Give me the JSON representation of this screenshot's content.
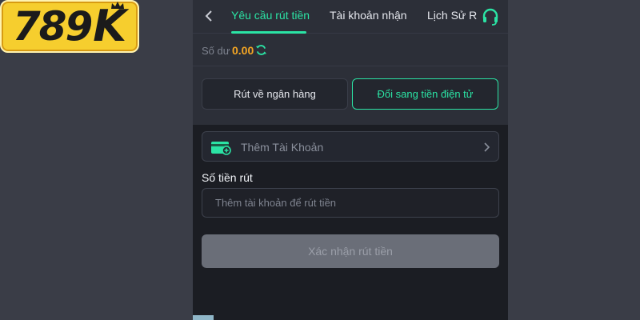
{
  "logo": {
    "numbers": "789",
    "letter": "K"
  },
  "tabs": [
    {
      "label": "Yêu cầu rút tiền",
      "active": true
    },
    {
      "label": "Tài khoản nhận",
      "active": false
    },
    {
      "label": "Lịch Sử R",
      "active": false
    }
  ],
  "balance": {
    "label": "Số dư",
    "value": "0.00"
  },
  "methods": {
    "bank": "Rút về ngân hàng",
    "crypto": "Đổi sang tiền điện tử",
    "selected": "crypto"
  },
  "add_account": {
    "label": "Thêm Tài Khoản"
  },
  "amount": {
    "label": "Số tiền rút",
    "placeholder": "Thêm tài khoản để rút tiền",
    "value": ""
  },
  "confirm_button": {
    "label": "Xác nhận rút tiền"
  },
  "colors": {
    "accent": "#2be3a4",
    "balance": "#f5a623",
    "page_bg": "#3a3d47",
    "panel_bg": "#1b1d23",
    "header_bg": "#2c2f38",
    "disabled_button": "#6a6e78",
    "logo_bg": "#f6ce2e"
  },
  "icons": {
    "back": "chevron-left-icon",
    "support": "headset-icon",
    "refresh": "refresh-icon",
    "card": "wallet-add-icon",
    "arrow": "chevron-right-icon"
  }
}
